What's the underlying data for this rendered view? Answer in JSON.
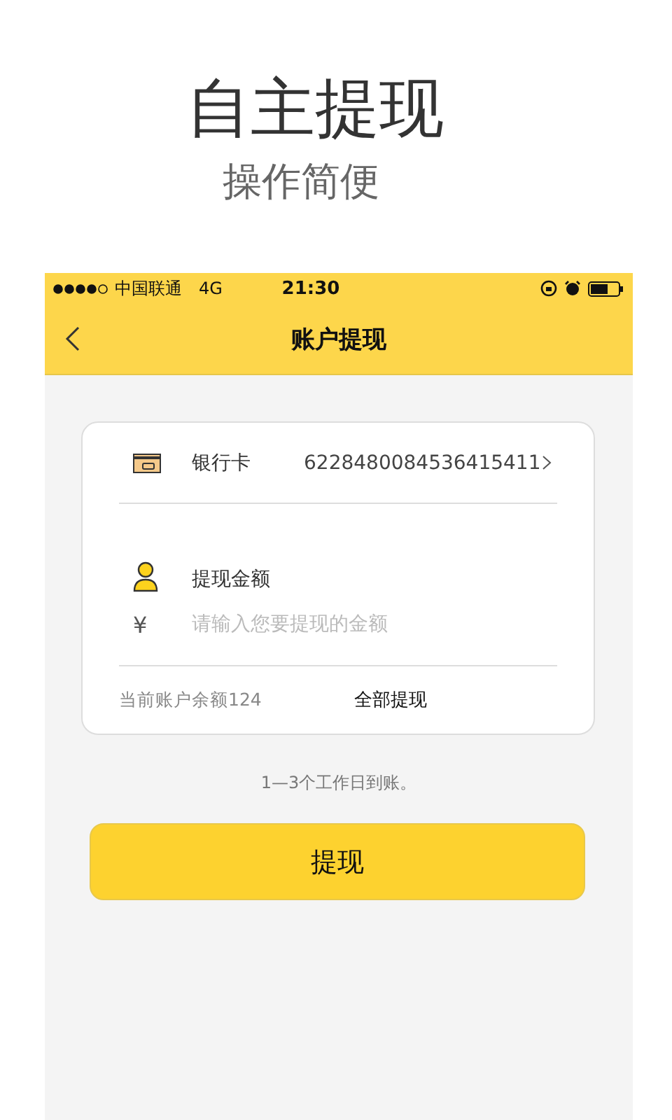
{
  "promo": {
    "headline": "自主提现",
    "subheadline": "操作简便"
  },
  "status_bar": {
    "carrier": "中国联通",
    "network": "4G",
    "time": "21:30"
  },
  "nav_bar": {
    "title": "账户提现"
  },
  "card": {
    "bank_row": {
      "label": "银行卡",
      "value": "6228480084536415411"
    },
    "amount_row": {
      "label": "提现金额"
    },
    "amount_field": {
      "prefix": "¥",
      "placeholder": "请输入您要提现的金额"
    },
    "balance": "当前账户余额124",
    "withdraw_all": "全部提现"
  },
  "hint": "1—3个工作日到账。",
  "submit_button": "提现"
}
